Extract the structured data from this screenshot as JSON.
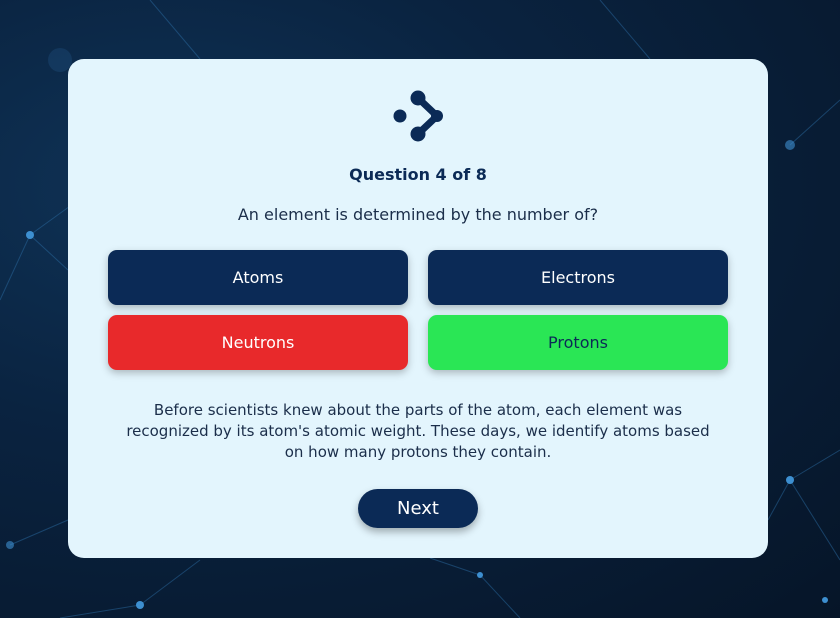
{
  "quiz": {
    "question_counter": "Question 4 of 8",
    "question": "An element is determined by the number of?",
    "answers": [
      {
        "label": "Atoms",
        "state": "default"
      },
      {
        "label": "Electrons",
        "state": "default"
      },
      {
        "label": "Neutrons",
        "state": "incorrect"
      },
      {
        "label": "Protons",
        "state": "correct"
      }
    ],
    "explanation": "Before scientists knew about the parts of the atom, each element was recognized by its atom's atomic weight. These days, we identify atoms based on how many protons they contain.",
    "next_label": "Next"
  },
  "colors": {
    "primary": "#0b2a56",
    "incorrect": "#e8292b",
    "correct": "#2ae655",
    "card": "#e3f5fd"
  },
  "icons": {
    "logo": "molecule-logo-icon"
  }
}
